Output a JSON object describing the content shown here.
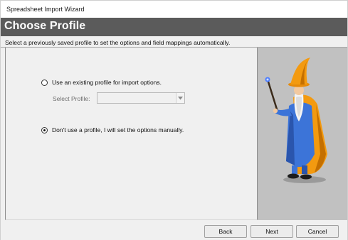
{
  "window": {
    "title": "Spreadsheet Import Wizard"
  },
  "header": {
    "heading": "Choose Profile",
    "background": "#5b5b5b"
  },
  "subtitle": "Select a previously saved profile to set the options and field mappings automatically.",
  "options": {
    "use_existing": {
      "label": "Use an existing profile for import options.",
      "selected": false
    },
    "select_profile": {
      "label": "Select Profile:",
      "value": "",
      "enabled": false
    },
    "manual": {
      "label": "Don't use a profile, I will set the options manually.",
      "selected": true
    }
  },
  "art": {
    "icon": "wizard-illustration"
  },
  "buttons": {
    "back": "Back",
    "next": "Next",
    "cancel": "Cancel"
  }
}
